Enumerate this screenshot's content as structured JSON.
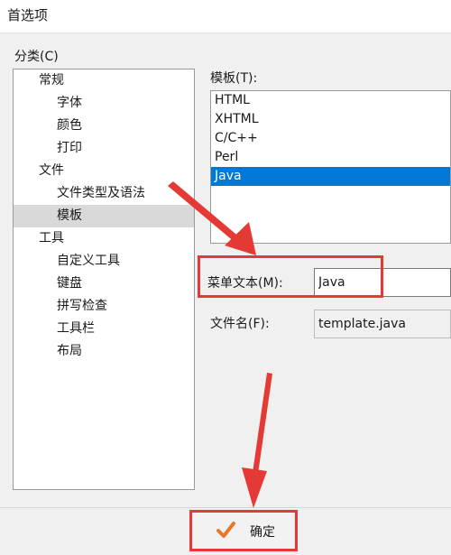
{
  "window": {
    "title": "首选项"
  },
  "category": {
    "label": "分类(C)",
    "items": [
      {
        "label": "常规"
      },
      {
        "label": "字体"
      },
      {
        "label": "颜色"
      },
      {
        "label": "打印"
      },
      {
        "label": "文件"
      },
      {
        "label": "文件类型及语法"
      },
      {
        "label": "模板"
      },
      {
        "label": "工具"
      },
      {
        "label": "自定义工具"
      },
      {
        "label": "键盘"
      },
      {
        "label": "拼写检查"
      },
      {
        "label": "工具栏"
      },
      {
        "label": "布局"
      }
    ]
  },
  "templates": {
    "label": "模板(T):",
    "items": [
      "HTML",
      "XHTML",
      "C/C++",
      "Perl",
      "Java"
    ],
    "selected": "Java"
  },
  "menu_text": {
    "label": "菜单文本(M):",
    "value": "Java"
  },
  "file_name": {
    "label": "文件名(F):",
    "value": "template.java"
  },
  "ok_button": {
    "label": "确定",
    "icon": "checkmark-icon"
  },
  "colors": {
    "selection": "#0078d7",
    "annotation": "#e53935",
    "check": "#e8772e"
  }
}
